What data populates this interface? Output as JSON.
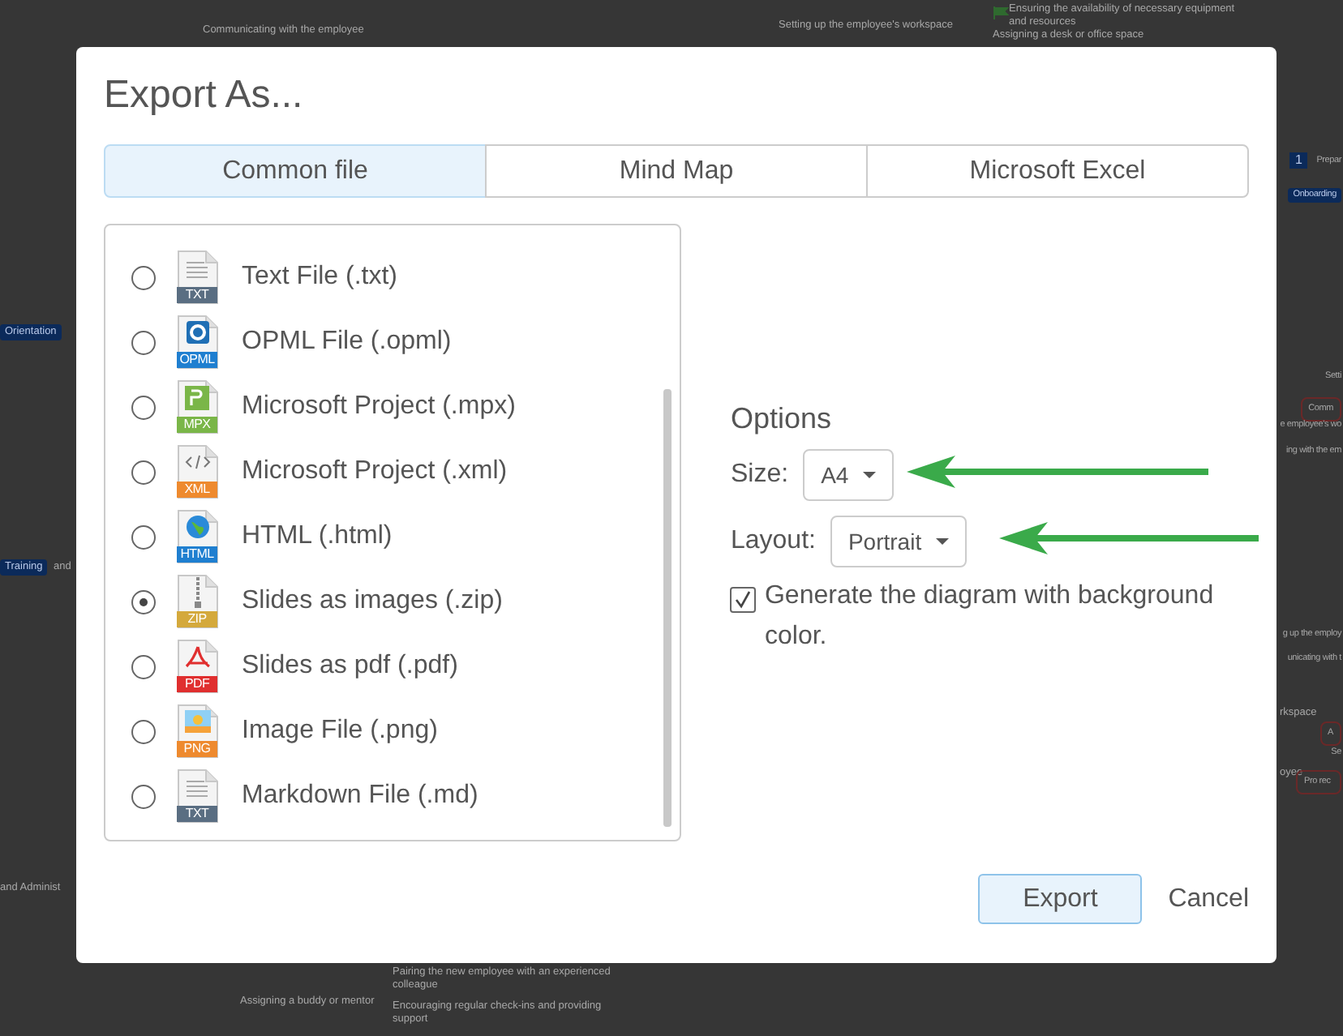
{
  "background_map": {
    "nodes": [
      {
        "text": "Communicating with the employee",
        "kind": "label"
      },
      {
        "text": "Setting up the employee's workspace",
        "kind": "label"
      },
      {
        "text": "Ensuring the availability of necessary equipment and resources",
        "kind": "label"
      },
      {
        "text": "Assigning a desk or office space",
        "kind": "label"
      },
      {
        "text": "Prepar",
        "kind": "numbered",
        "number": "1"
      },
      {
        "text": "Onboarding",
        "kind": "tag"
      },
      {
        "text": "Orientation",
        "kind": "tag"
      },
      {
        "text": "Setti",
        "kind": "label"
      },
      {
        "text": "Comm",
        "kind": "box"
      },
      {
        "text": "e employee's wo",
        "kind": "label"
      },
      {
        "text": "ing with the em",
        "kind": "label"
      },
      {
        "text": "Training",
        "kind": "tag"
      },
      {
        "text": "and",
        "kind": "label"
      },
      {
        "text": "g up the employ",
        "kind": "label"
      },
      {
        "text": "unicating with t",
        "kind": "label"
      },
      {
        "text": "rkspace",
        "kind": "label"
      },
      {
        "text": "A",
        "kind": "box"
      },
      {
        "text": "Se",
        "kind": "label"
      },
      {
        "text": "oyee",
        "kind": "label"
      },
      {
        "text": "Pro rec",
        "kind": "box"
      },
      {
        "text": "and Administ",
        "kind": "label"
      },
      {
        "text": "Pairing the new employee with an experienced colleague",
        "kind": "label"
      },
      {
        "text": "Assigning a buddy or mentor",
        "kind": "label"
      },
      {
        "text": "Encouraging regular check-ins and providing support",
        "kind": "label"
      }
    ]
  },
  "dialog": {
    "title": "Export As...",
    "tabs": [
      {
        "label": "Common file",
        "selected": true
      },
      {
        "label": "Mind Map",
        "selected": false
      },
      {
        "label": "Microsoft Excel",
        "selected": false
      }
    ],
    "formats": [
      {
        "label": "Text File (.txt)",
        "badge": "TXT",
        "kind": "text",
        "color": "#5a6e82",
        "selected": false
      },
      {
        "label": "OPML File (.opml)",
        "badge": "OPML",
        "kind": "opml",
        "color": "#1f7fd0",
        "selected": false
      },
      {
        "label": "Microsoft Project (.mpx)",
        "badge": "MPX",
        "kind": "project",
        "color": "#7ab648",
        "selected": false
      },
      {
        "label": "Microsoft Project (.xml)",
        "badge": "XML",
        "kind": "xml",
        "color": "#ee8a2e",
        "selected": false
      },
      {
        "label": "HTML (.html)",
        "badge": "HTML",
        "kind": "html",
        "color": "#1f7fd0",
        "selected": false
      },
      {
        "label": "Slides as images (.zip)",
        "badge": "ZIP",
        "kind": "zip",
        "color": "#d4a93c",
        "selected": true
      },
      {
        "label": "Slides as pdf (.pdf)",
        "badge": "PDF",
        "kind": "pdf",
        "color": "#e02f2f",
        "selected": false
      },
      {
        "label": "Image File (.png)",
        "badge": "PNG",
        "kind": "image",
        "color": "#ee8a2e",
        "selected": false
      },
      {
        "label": "Markdown File (.md)",
        "badge": "TXT",
        "kind": "text",
        "color": "#5a6e82",
        "selected": false
      }
    ],
    "options": {
      "heading": "Options",
      "size": {
        "label": "Size:",
        "value": "A4"
      },
      "layout": {
        "label": "Layout:",
        "value": "Portrait"
      },
      "background_checkbox": {
        "label": "Generate the diagram with background color.",
        "checked": true
      }
    },
    "buttons": {
      "export": "Export",
      "cancel": "Cancel"
    }
  }
}
